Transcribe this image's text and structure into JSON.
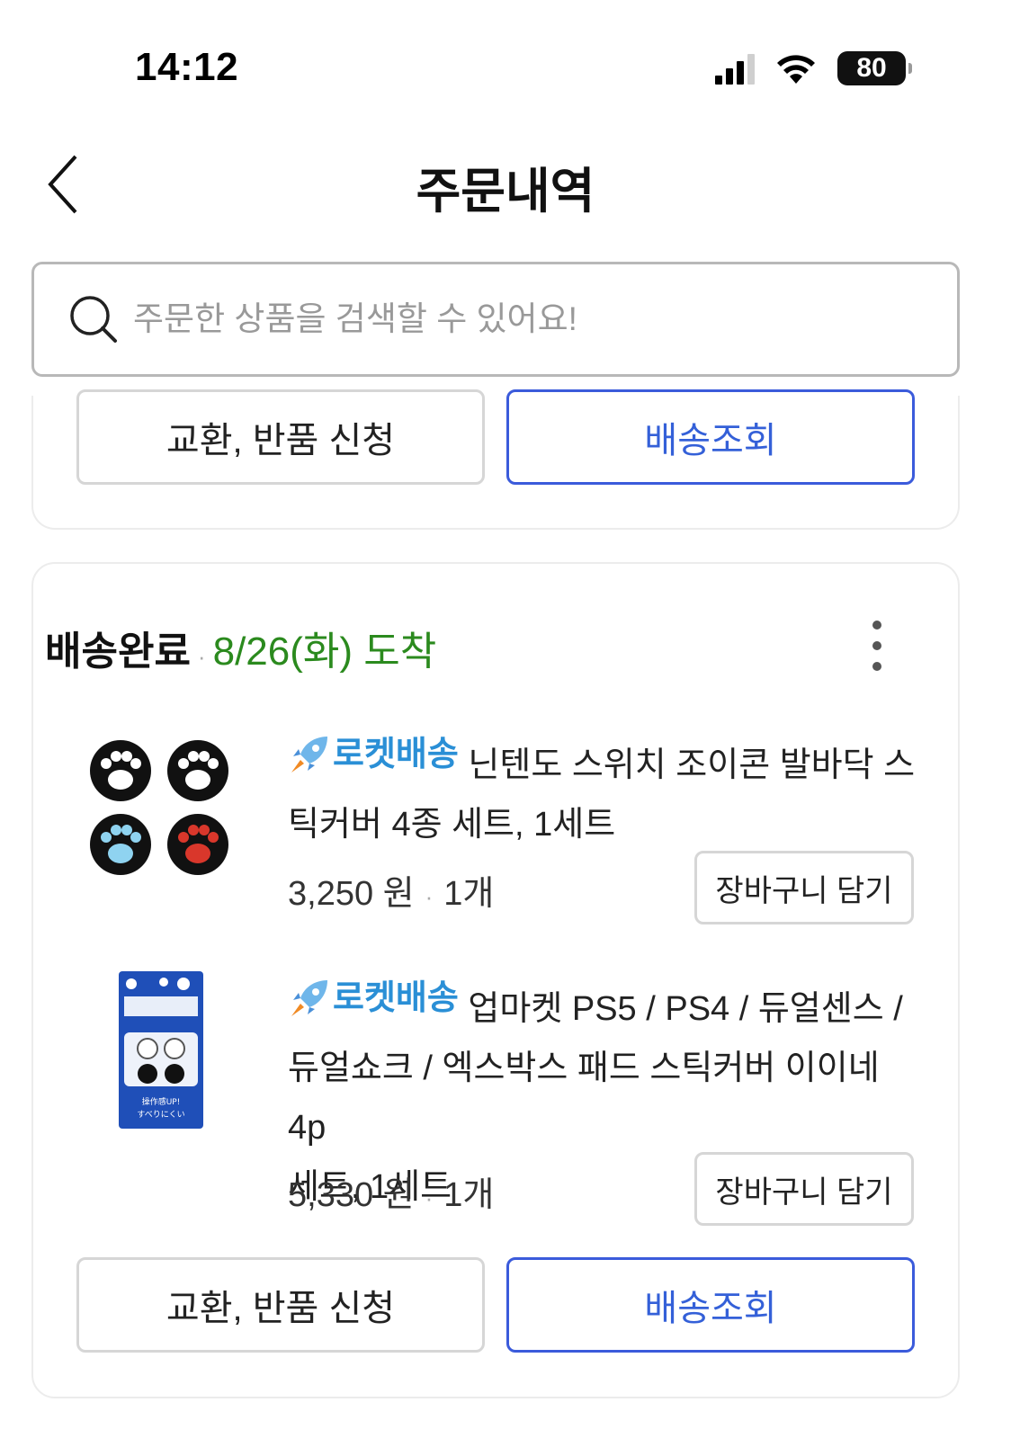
{
  "status_bar": {
    "time": "14:12",
    "battery": "80",
    "icons": [
      "signal-icon",
      "wifi-icon",
      "battery-icon"
    ]
  },
  "header": {
    "title": "주문내역",
    "back_icon": "chevron-left-icon"
  },
  "search": {
    "placeholder": "주문한 상품을 검색할 수 있어요!",
    "icon": "search-icon"
  },
  "previous_order": {
    "exchange_label": "교환, 반품 신청",
    "track_label": "배송조회"
  },
  "order": {
    "status": "배송완료",
    "delivery_date": "8/26(화) 도착",
    "items": [
      {
        "badge": "로켓배송",
        "name": "닌텐도 스위치 조이콘 발바닥 스틱커버 4종 세트, 1세트",
        "name_line1": "닌텐도 스위치 조이콘 발바닥 스",
        "name_line2": "틱커버 4종 세트, 1세트",
        "price": "3,250 원",
        "quantity": "1개",
        "cart_label": "장바구니 담기"
      },
      {
        "badge": "로켓배송",
        "name": "업마켓 PS5 / PS4 / 듀얼센스 / 듀얼쇼크 / 엑스박스 패드 스틱커버 이이네 4p 세트, 1세트",
        "name_line1": "업마켓 PS5 / PS4 / 듀얼센스 /",
        "name_line2": "듀얼쇼크 / 엑스박스 패드 스틱커버 이이네 4p",
        "name_line3": "세트, 1세트",
        "price": "5,330 원",
        "quantity": "1개",
        "cart_label": "장바구니 담기",
        "package_text": "操作感UP! すべりにくい"
      }
    ],
    "exchange_label": "교환, 반품 신청",
    "track_label": "배송조회"
  },
  "colors": {
    "accent_blue": "#3b5bdb",
    "delivered_green": "#2b8a1e",
    "rocket_blue": "#2a8fd6"
  }
}
